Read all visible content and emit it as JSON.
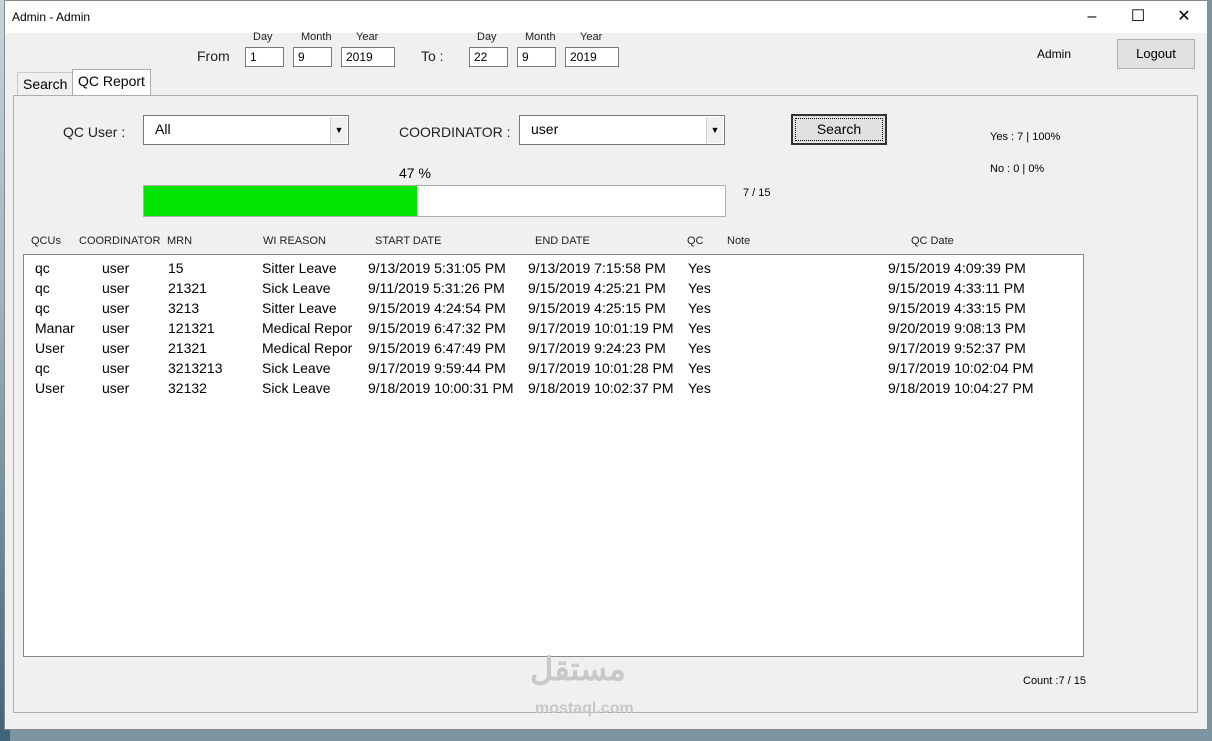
{
  "window": {
    "title": "Admin -  Admin"
  },
  "header": {
    "from_label": "From",
    "to_label": "To :",
    "day_label": "Day",
    "month_label": "Month",
    "year_label": "Year",
    "from": {
      "day": "1",
      "month": "9",
      "year": "2019"
    },
    "to": {
      "day": "22",
      "month": "9",
      "year": "2019"
    },
    "user_name": "Admin",
    "logout_label": "Logout"
  },
  "tabs": [
    {
      "label": "Search"
    },
    {
      "label": "QC Report"
    }
  ],
  "filters": {
    "qc_user_label": "QC User :",
    "qc_user_value": "All",
    "coordinator_label": "COORDINATOR :",
    "coordinator_value": "user",
    "search_label": "Search"
  },
  "stats": {
    "yes_text": "Yes : 7  |  100%",
    "no_text": "No : 0  |  0%",
    "percent_text": "47 %",
    "progress_fraction": 0.47,
    "progress_count_text": "7   / 15",
    "count_text": "Count :7    /  15"
  },
  "table": {
    "columns": [
      "QCUs",
      "COORDINATOR",
      "MRN",
      "WI REASON",
      "START DATE",
      "END DATE",
      "QC",
      "Note",
      "QC Date"
    ],
    "rows": [
      [
        "qc",
        "user",
        "15",
        "Sitter Leave",
        "9/13/2019 5:31:05 PM",
        "9/13/2019 7:15:58 PM",
        "Yes",
        "",
        "9/15/2019 4:09:39 PM"
      ],
      [
        "qc",
        "user",
        "21321",
        "Sick Leave",
        "9/11/2019 5:31:26 PM",
        "9/15/2019 4:25:21 PM",
        "Yes",
        "",
        "9/15/2019 4:33:11 PM"
      ],
      [
        "qc",
        "user",
        "3213",
        "Sitter Leave",
        "9/15/2019 4:24:54 PM",
        "9/15/2019 4:25:15 PM",
        "Yes",
        "",
        "9/15/2019 4:33:15 PM"
      ],
      [
        "Manar",
        "user",
        "121321",
        "Medical Repor",
        "9/15/2019 6:47:32 PM",
        "9/17/2019 10:01:19 PM",
        "Yes",
        "",
        "9/20/2019 9:08:13 PM"
      ],
      [
        "User",
        "user",
        "21321",
        "Medical Repor",
        "9/15/2019 6:47:49 PM",
        "9/17/2019 9:24:23 PM",
        "Yes",
        "",
        "9/17/2019 9:52:37 PM"
      ],
      [
        "qc",
        "user",
        "3213213",
        "Sick Leave",
        "9/17/2019 9:59:44 PM",
        "9/17/2019 10:01:28 PM",
        "Yes",
        "",
        "9/17/2019 10:02:04 PM"
      ],
      [
        "User",
        "user",
        "32132",
        "Sick Leave",
        "9/18/2019 10:00:31 PM",
        "9/18/2019 10:02:37 PM",
        "Yes",
        "",
        "9/18/2019 10:04:27 PM"
      ]
    ]
  },
  "watermark": {
    "text": "مستقل",
    "sub": "mostaql.com"
  },
  "colors": {
    "progress_fill": "#00e400"
  }
}
